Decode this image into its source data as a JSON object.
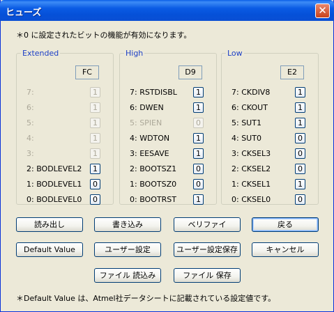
{
  "window": {
    "title": "ヒューズ",
    "close_glyph": "✕"
  },
  "note": "＊0 に設定されたビットの機能が有効になります。",
  "groups": [
    {
      "name": "Extended",
      "hex": "FC",
      "bits": [
        {
          "label": "7:",
          "value": "1",
          "enabled": false
        },
        {
          "label": "6:",
          "value": "1",
          "enabled": false
        },
        {
          "label": "5:",
          "value": "1",
          "enabled": false
        },
        {
          "label": "4:",
          "value": "1",
          "enabled": false
        },
        {
          "label": "3:",
          "value": "1",
          "enabled": false
        },
        {
          "label": "2: BODLEVEL2",
          "value": "1",
          "enabled": true
        },
        {
          "label": "1: BODLEVEL1",
          "value": "0",
          "enabled": true
        },
        {
          "label": "0: BODLEVEL0",
          "value": "0",
          "enabled": true
        }
      ]
    },
    {
      "name": "High",
      "hex": "D9",
      "bits": [
        {
          "label": "7: RSTDISBL",
          "value": "1",
          "enabled": true
        },
        {
          "label": "6: DWEN",
          "value": "1",
          "enabled": true
        },
        {
          "label": "5: SPIEN",
          "value": "0",
          "enabled": false
        },
        {
          "label": "4: WDTON",
          "value": "1",
          "enabled": true
        },
        {
          "label": "3: EESAVE",
          "value": "1",
          "enabled": true
        },
        {
          "label": "2: BOOTSZ1",
          "value": "0",
          "enabled": true
        },
        {
          "label": "1: BOOTSZ0",
          "value": "0",
          "enabled": true
        },
        {
          "label": "0: BOOTRST",
          "value": "1",
          "enabled": true
        }
      ]
    },
    {
      "name": "Low",
      "hex": "E2",
      "bits": [
        {
          "label": "7: CKDIV8",
          "value": "1",
          "enabled": true
        },
        {
          "label": "6: CKOUT",
          "value": "1",
          "enabled": true
        },
        {
          "label": "5: SUT1",
          "value": "1",
          "enabled": true
        },
        {
          "label": "4: SUT0",
          "value": "0",
          "enabled": true
        },
        {
          "label": "3: CKSEL3",
          "value": "0",
          "enabled": true
        },
        {
          "label": "2: CKSEL2",
          "value": "0",
          "enabled": true
        },
        {
          "label": "1: CKSEL1",
          "value": "1",
          "enabled": true
        },
        {
          "label": "0: CKSEL0",
          "value": "0",
          "enabled": true
        }
      ]
    }
  ],
  "buttons": {
    "read": "読み出し",
    "write": "書き込み",
    "verify": "ベリファイ",
    "back": "戻る",
    "default_value": "Default Value",
    "user_settings": "ユーザー設定",
    "save_user_settings": "ユーザー設定保存",
    "cancel": "キャンセル",
    "load_file": "ファイル 読込み",
    "save_file": "ファイル 保存"
  },
  "footer": "＊Default Value は、Atmel社データシートに記載されている設定値です。"
}
